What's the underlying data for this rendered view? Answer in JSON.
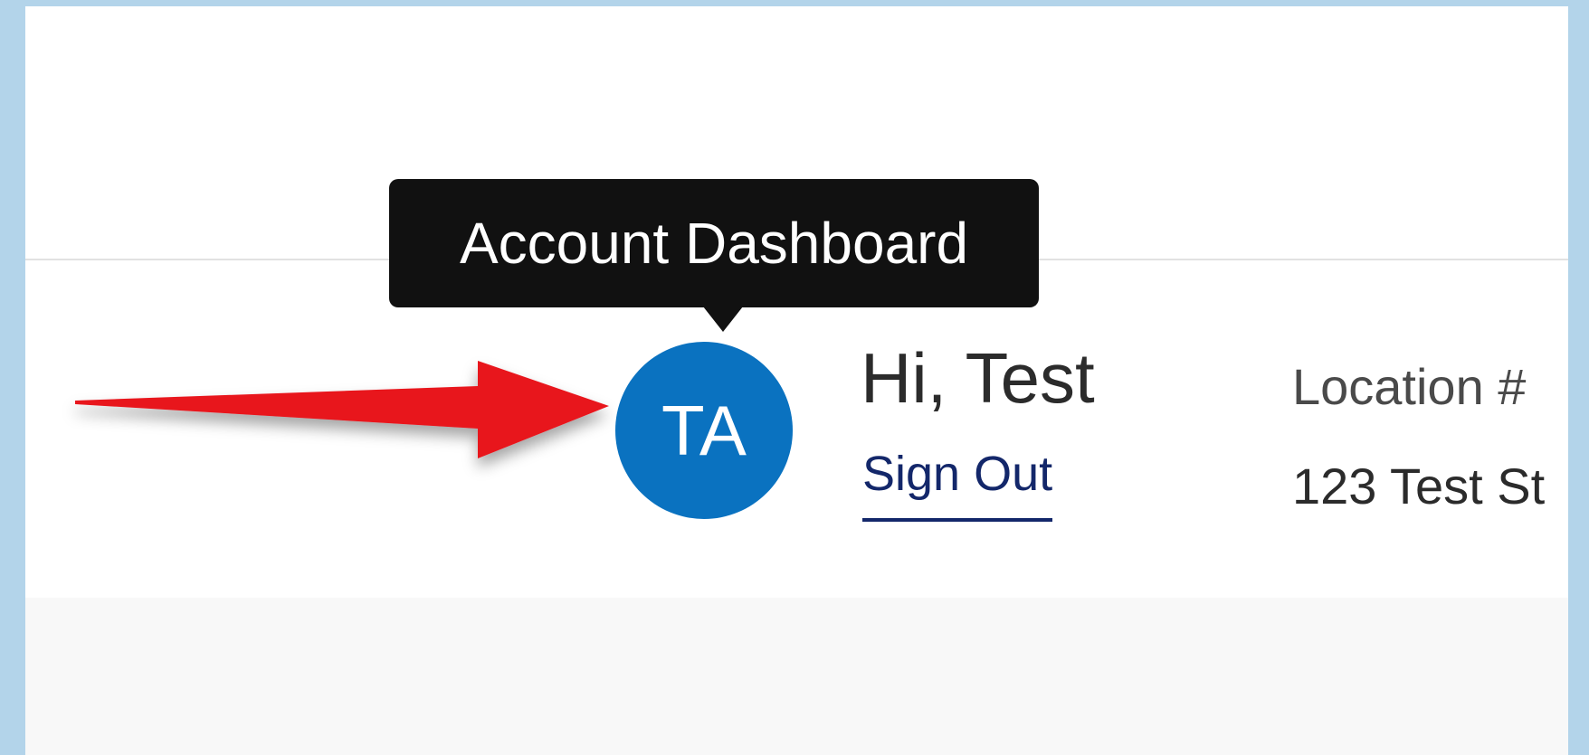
{
  "tooltip": {
    "text": "Account Dashboard"
  },
  "account": {
    "initials": "TA",
    "greeting": "Hi, Test",
    "sign_out_label": "Sign Out"
  },
  "location": {
    "label": "Location #",
    "address": "123 Test St"
  },
  "icons": {
    "annotation": "red-arrow-icon"
  },
  "colors": {
    "avatar_background": "#0a72c0",
    "tooltip_background": "#111111",
    "sign_out_link": "#13276a",
    "arrow": "#e8141f",
    "outer_background": "#b3d4ea"
  }
}
